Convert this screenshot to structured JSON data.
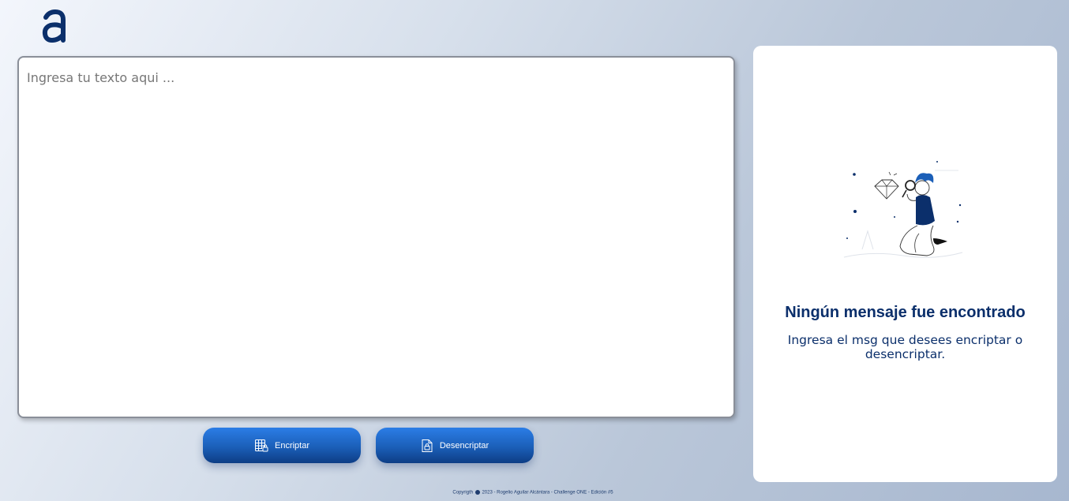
{
  "app": {
    "logo_alt": "a"
  },
  "input": {
    "placeholder": "Ingresa tu texto aqui ...",
    "value": ""
  },
  "buttons": {
    "encrypt_label": "Encriptar",
    "decrypt_label": "Desencriptar"
  },
  "result": {
    "title": "Ningún mensaje fue encontrado",
    "text": "Ingresa el msg que desees encriptar o desencriptar."
  },
  "footer": {
    "text_before": "Copyrigth",
    "text_after": "2023 - Rogelio Aguilar Alcántara - Challenge ONE - Edición #5"
  },
  "colors": {
    "primary": "#0b2f6b",
    "button_top": "#2b7de6",
    "button_bottom": "#0d3d85"
  },
  "icons": {
    "logo": "alura-a-logo",
    "encrypt": "table-lock-icon",
    "decrypt": "file-lock-icon",
    "footer_info": "info-circle-icon",
    "illustration": "person-with-magnifier-illustration"
  }
}
